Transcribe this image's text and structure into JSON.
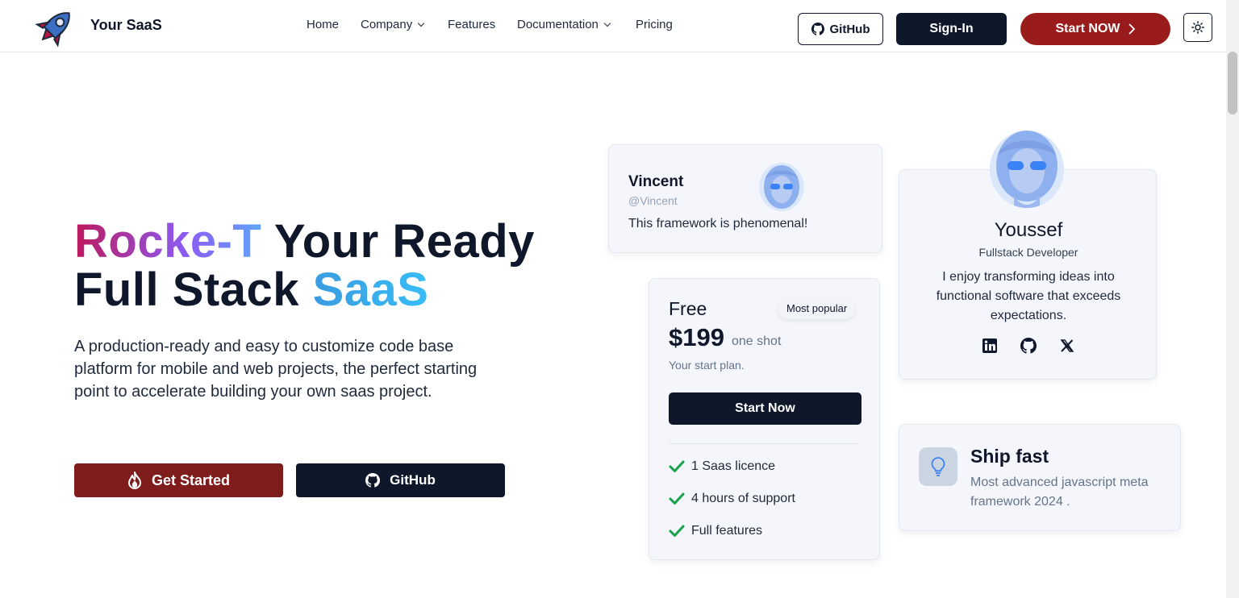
{
  "header": {
    "brand": "Your SaaS",
    "logo_icon": "rocket-icon",
    "nav": [
      {
        "label": "Home",
        "has_dropdown": false
      },
      {
        "label": "Company",
        "has_dropdown": true
      },
      {
        "label": "Features",
        "has_dropdown": false
      },
      {
        "label": "Documentation",
        "has_dropdown": true
      },
      {
        "label": "Pricing",
        "has_dropdown": false
      }
    ],
    "github_label": "GitHub",
    "signin_label": "Sign-In",
    "start_label": "Start NOW",
    "theme_icon": "sun-icon"
  },
  "hero": {
    "title_part1": "Rocke-T",
    "title_part2": " Your Ready",
    "title_part3": "Full Stack ",
    "title_part4": "SaaS",
    "description": "A production-ready and easy to customize code base platform for mobile and web projects, the perfect starting point to accelerate building your own saas project.",
    "get_started_label": "Get Started",
    "github_label": "GitHub"
  },
  "testimonial": {
    "name": "Vincent",
    "handle": "@Vincent",
    "text": "This framework is phenomenal!"
  },
  "profile": {
    "name": "Youssef",
    "role": "Fullstack Developer",
    "bio": "I enjoy transforming ideas into functional software that exceeds expectations.",
    "socials": [
      "linkedin-icon",
      "github-icon",
      "x-icon"
    ]
  },
  "pricing": {
    "plan": "Free",
    "badge": "Most popular",
    "price": "$199",
    "period": "one shot",
    "subtitle": "Your start plan.",
    "cta": "Start Now",
    "features": [
      "1 Saas licence",
      "4 hours of support",
      "Full features"
    ]
  },
  "feature_card": {
    "icon": "lightbulb-icon",
    "title": "Ship fast",
    "text": "Most advanced javascript meta framework 2024 ."
  },
  "colors": {
    "primary_dark": "#0f172a",
    "accent_red": "#991b1b",
    "check_green": "#16a34a"
  }
}
